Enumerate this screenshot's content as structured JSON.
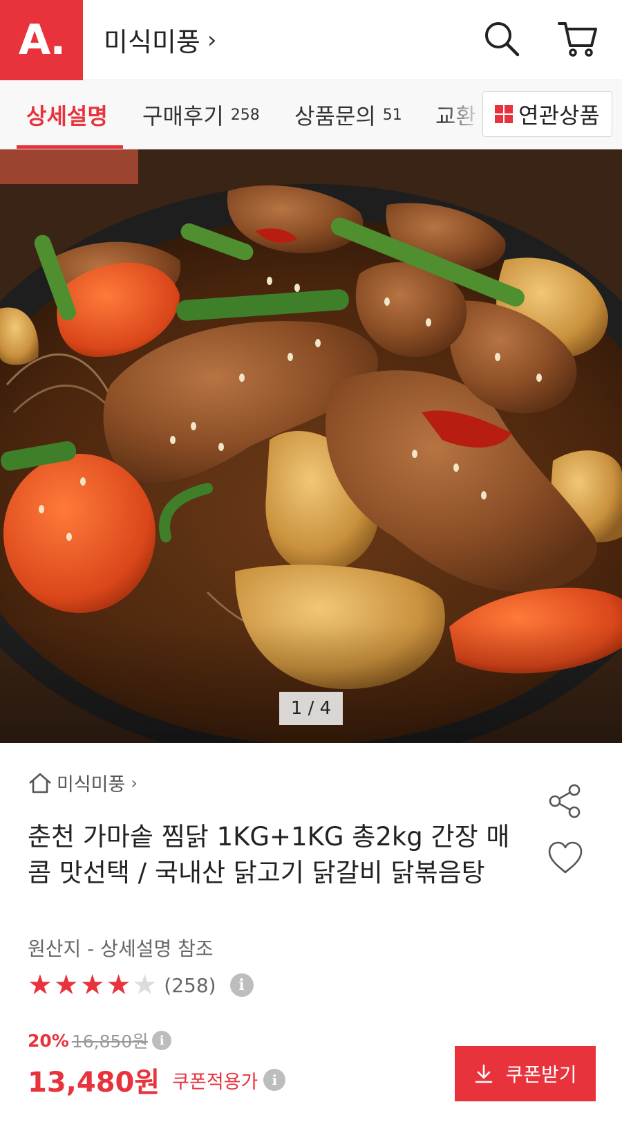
{
  "header": {
    "logo_text": "A.",
    "store_name": "미식미풍",
    "chevron": "›",
    "search_icon": "search-icon",
    "cart_icon": "cart-icon"
  },
  "tabs": [
    {
      "label": "상세설명",
      "count": "",
      "active": true
    },
    {
      "label": "구매후기",
      "count": "258",
      "active": false
    },
    {
      "label": "상품문의",
      "count": "51",
      "active": false
    },
    {
      "label": "교환",
      "count": "",
      "active": false
    }
  ],
  "related_button": {
    "label": "연관상품",
    "icon": "grid-icon"
  },
  "gallery": {
    "counter": "1 / 4"
  },
  "product": {
    "breadcrumb": "미식미풍",
    "title": "춘천 가마솥 찜닭 1KG+1KG 총2kg 간장 매콤 맛선택 / 국내산 닭고기 닭갈비 닭볶음탕",
    "origin": "원산지 - 상세설명 참조",
    "rating": 4,
    "rating_max": 5,
    "review_count": "(258)",
    "discount_rate": "20%",
    "original_price": "16,850원",
    "sale_price": "13,480원",
    "price_note": "쿠폰적용가",
    "coupon_button": "쿠폰받기"
  },
  "colors": {
    "accent": "#e8333d",
    "star_empty": "#dcdcdc",
    "info_icon": "#bdbdbd"
  }
}
